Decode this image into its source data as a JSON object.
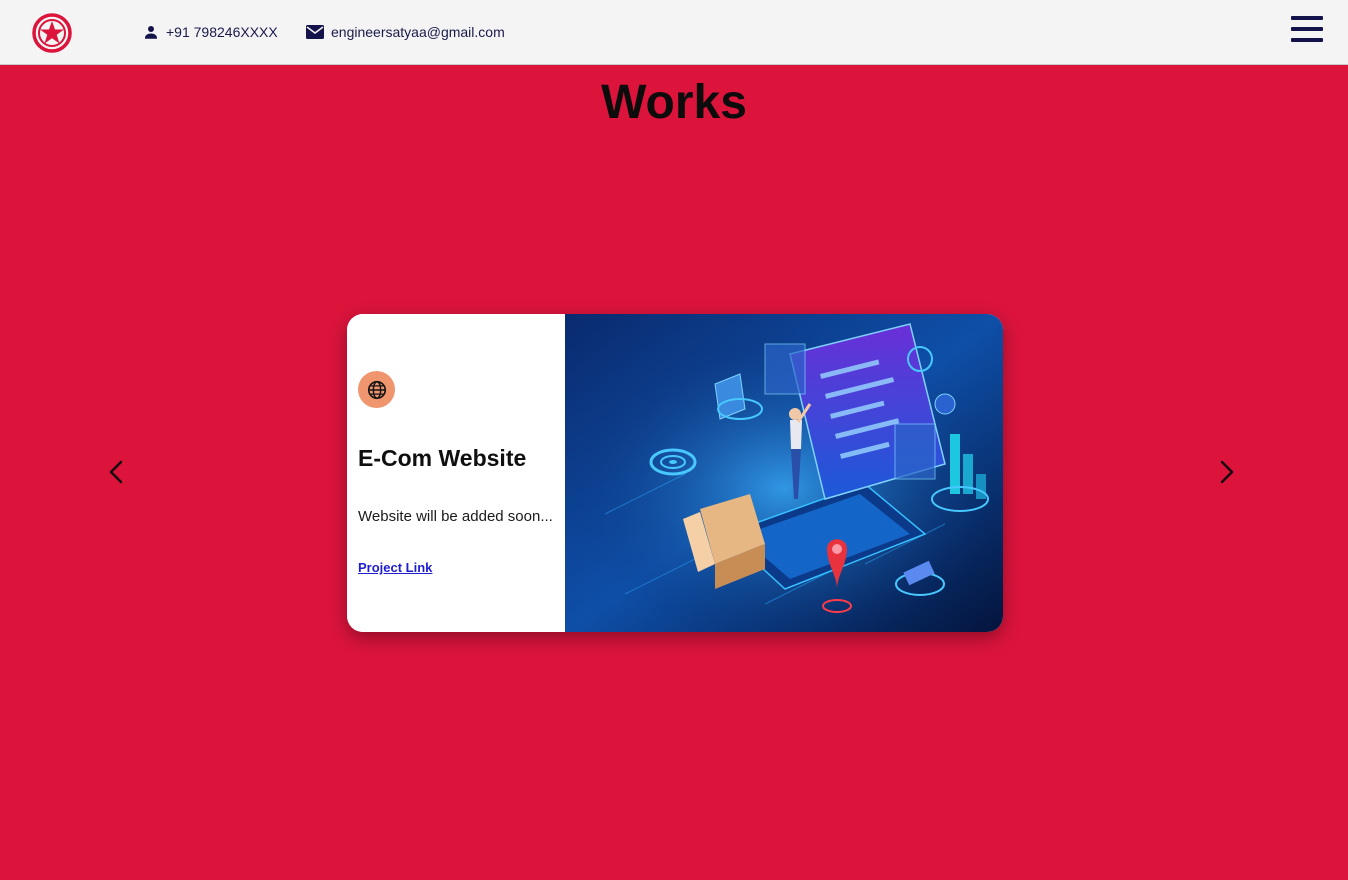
{
  "header": {
    "phone": "+91 798246XXXX",
    "email": "engineersatyaa@gmail.com",
    "phone_icon": "person-icon",
    "email_icon": "mail-icon",
    "menu_icon": "hamburger-menu-icon",
    "logo_icon": "star-logo-icon"
  },
  "section": {
    "title": "Works"
  },
  "carousel": {
    "prev_icon": "chevron-left-icon",
    "next_icon": "chevron-right-icon",
    "card": {
      "icon": "globe-icon",
      "title": "E-Com Website",
      "description": "Website will be added soon...",
      "link_label": "Project Link",
      "image_subject": "isometric e-commerce laptop illustration"
    }
  },
  "colors": {
    "page_background": "#dc143c",
    "header_background": "#f4f4f4",
    "accent": "#13124a",
    "badge": "#f0966e",
    "link": "#1f1fd0"
  }
}
